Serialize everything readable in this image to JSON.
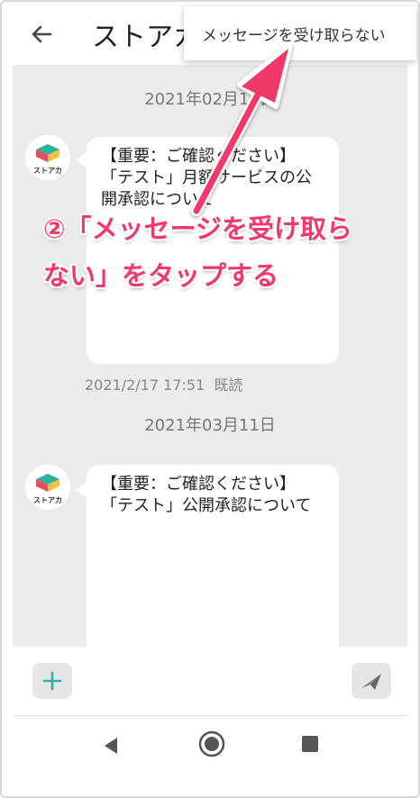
{
  "appbar": {
    "title": "ストアカ",
    "back_icon": "arrow-left-icon"
  },
  "menu": {
    "item_label": "メッセージを受け取らない"
  },
  "chat": {
    "messages": [
      {
        "date": "2021年02月17日",
        "avatar_label": "ストアカ",
        "lines": [
          "【重要：ご確認ください】",
          "「テスト」月額サービスの公",
          "開承認について"
        ],
        "timestamp": "2021/2/17 17:51",
        "read": "既読"
      },
      {
        "date": "2021年03月11日",
        "avatar_label": "ストアカ",
        "lines": [
          "【重要：ご確認ください】",
          "「テスト」公開承認について"
        ]
      }
    ]
  },
  "annotation": {
    "line1": "②「メッセージを受け取ら",
    "line2": "ない」をタップする",
    "color": "#f0386b"
  },
  "composer": {
    "plus_icon": "plus-icon",
    "send_icon": "send-icon"
  },
  "navbar": {
    "back": "nav-back-icon",
    "home": "nav-home-icon",
    "recents": "nav-recents-icon"
  }
}
